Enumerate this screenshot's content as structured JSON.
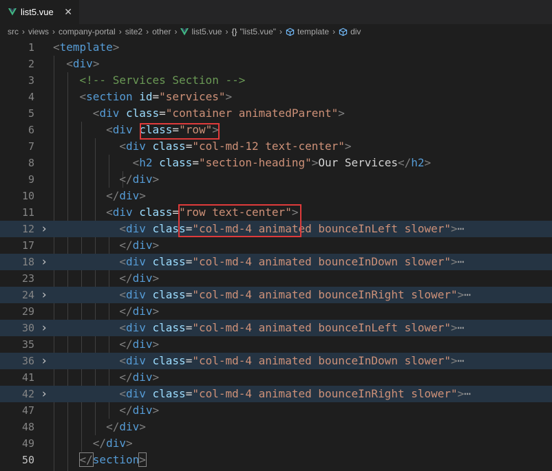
{
  "tab": {
    "title": "list5.vue",
    "close": "✕"
  },
  "breadcrumb": {
    "items": [
      {
        "label": "src",
        "icon": null
      },
      {
        "label": "views",
        "icon": null
      },
      {
        "label": "company-portal",
        "icon": null
      },
      {
        "label": "site2",
        "icon": null
      },
      {
        "label": "other",
        "icon": null
      },
      {
        "label": "list5.vue",
        "icon": "vue-icon"
      },
      {
        "label": "\"list5.vue\"",
        "icon": "braces-icon",
        "icon_text": "{}"
      },
      {
        "label": "template",
        "icon": "cube-icon"
      },
      {
        "label": "div",
        "icon": "cube-icon"
      }
    ],
    "separator": "›"
  },
  "colors": {
    "vue_green": "#41b883",
    "highlight_red": "#e03b3b",
    "folded_bg": "#253443"
  },
  "lines": [
    {
      "num": "1",
      "tokens": [
        [
          "br",
          "<"
        ],
        [
          "tag",
          "template"
        ],
        [
          "br",
          ">"
        ]
      ]
    },
    {
      "num": "2",
      "tokens": [
        [
          "tx",
          "  "
        ],
        [
          "br",
          "<"
        ],
        [
          "tag",
          "div"
        ],
        [
          "br",
          ">"
        ]
      ]
    },
    {
      "num": "3",
      "tokens": [
        [
          "tx",
          "    "
        ],
        [
          "cmt",
          "<!-- Services Section -->"
        ]
      ]
    },
    {
      "num": "4",
      "tokens": [
        [
          "tx",
          "    "
        ],
        [
          "br",
          "<"
        ],
        [
          "tag",
          "section"
        ],
        [
          "tx",
          " "
        ],
        [
          "attr",
          "id"
        ],
        [
          "tx",
          "="
        ],
        [
          "str",
          "\"services\""
        ],
        [
          "br",
          ">"
        ]
      ]
    },
    {
      "num": "5",
      "tokens": [
        [
          "tx",
          "      "
        ],
        [
          "br",
          "<"
        ],
        [
          "tag",
          "div"
        ],
        [
          "tx",
          " "
        ],
        [
          "attr",
          "class"
        ],
        [
          "tx",
          "="
        ],
        [
          "str",
          "\"container animatedParent\""
        ],
        [
          "br",
          ">"
        ]
      ]
    },
    {
      "num": "6",
      "tokens": [
        [
          "tx",
          "        "
        ],
        [
          "br",
          "<"
        ],
        [
          "tag",
          "div"
        ],
        [
          "tx",
          " "
        ],
        [
          "attr",
          "class"
        ],
        [
          "tx",
          "="
        ],
        [
          "str",
          "\"row\""
        ],
        [
          "br",
          ">"
        ]
      ]
    },
    {
      "num": "7",
      "tokens": [
        [
          "tx",
          "          "
        ],
        [
          "br",
          "<"
        ],
        [
          "tag",
          "div"
        ],
        [
          "tx",
          " "
        ],
        [
          "attr",
          "class"
        ],
        [
          "tx",
          "="
        ],
        [
          "str",
          "\"col-md-12 text-center\""
        ],
        [
          "br",
          ">"
        ]
      ]
    },
    {
      "num": "8",
      "tokens": [
        [
          "tx",
          "            "
        ],
        [
          "br",
          "<"
        ],
        [
          "tag",
          "h2"
        ],
        [
          "tx",
          " "
        ],
        [
          "attr",
          "class"
        ],
        [
          "tx",
          "="
        ],
        [
          "str",
          "\"section-heading\""
        ],
        [
          "br",
          ">"
        ],
        [
          "tx",
          "Our Services"
        ],
        [
          "br",
          "</"
        ],
        [
          "tag",
          "h2"
        ],
        [
          "br",
          ">"
        ]
      ]
    },
    {
      "num": "9",
      "tokens": [
        [
          "tx",
          "          "
        ],
        [
          "br",
          "</"
        ],
        [
          "tag",
          "div"
        ],
        [
          "br",
          ">"
        ]
      ]
    },
    {
      "num": "10",
      "tokens": [
        [
          "tx",
          "        "
        ],
        [
          "br",
          "</"
        ],
        [
          "tag",
          "div"
        ],
        [
          "br",
          ">"
        ]
      ]
    },
    {
      "num": "11",
      "tokens": [
        [
          "tx",
          "        "
        ],
        [
          "br",
          "<"
        ],
        [
          "tag",
          "div"
        ],
        [
          "tx",
          " "
        ],
        [
          "attr",
          "class"
        ],
        [
          "tx",
          "="
        ],
        [
          "str",
          "\"row text-center\""
        ],
        [
          "br",
          ">"
        ]
      ]
    },
    {
      "num": "12",
      "folded": true,
      "tokens": [
        [
          "tx",
          "          "
        ],
        [
          "br",
          "<"
        ],
        [
          "tag",
          "div"
        ],
        [
          "tx",
          " "
        ],
        [
          "attr",
          "class"
        ],
        [
          "tx",
          "="
        ],
        [
          "str",
          "\"col-md-4 animated bounceInLeft slower\""
        ],
        [
          "br",
          ">"
        ],
        [
          "dots",
          "⋯"
        ]
      ]
    },
    {
      "num": "17",
      "tokens": [
        [
          "tx",
          "          "
        ],
        [
          "br",
          "</"
        ],
        [
          "tag",
          "div"
        ],
        [
          "br",
          ">"
        ]
      ]
    },
    {
      "num": "18",
      "folded": true,
      "tokens": [
        [
          "tx",
          "          "
        ],
        [
          "br",
          "<"
        ],
        [
          "tag",
          "div"
        ],
        [
          "tx",
          " "
        ],
        [
          "attr",
          "class"
        ],
        [
          "tx",
          "="
        ],
        [
          "str",
          "\"col-md-4 animated bounceInDown slower\""
        ],
        [
          "br",
          ">"
        ],
        [
          "dots",
          "⋯"
        ]
      ]
    },
    {
      "num": "23",
      "tokens": [
        [
          "tx",
          "          "
        ],
        [
          "br",
          "</"
        ],
        [
          "tag",
          "div"
        ],
        [
          "br",
          ">"
        ]
      ]
    },
    {
      "num": "24",
      "folded": true,
      "tokens": [
        [
          "tx",
          "          "
        ],
        [
          "br",
          "<"
        ],
        [
          "tag",
          "div"
        ],
        [
          "tx",
          " "
        ],
        [
          "attr",
          "class"
        ],
        [
          "tx",
          "="
        ],
        [
          "str",
          "\"col-md-4 animated bounceInRight slower\""
        ],
        [
          "br",
          ">"
        ],
        [
          "dots",
          "⋯"
        ]
      ]
    },
    {
      "num": "29",
      "tokens": [
        [
          "tx",
          "          "
        ],
        [
          "br",
          "</"
        ],
        [
          "tag",
          "div"
        ],
        [
          "br",
          ">"
        ]
      ]
    },
    {
      "num": "30",
      "folded": true,
      "tokens": [
        [
          "tx",
          "          "
        ],
        [
          "br",
          "<"
        ],
        [
          "tag",
          "div"
        ],
        [
          "tx",
          " "
        ],
        [
          "attr",
          "class"
        ],
        [
          "tx",
          "="
        ],
        [
          "str",
          "\"col-md-4 animated bounceInLeft slower\""
        ],
        [
          "br",
          ">"
        ],
        [
          "dots",
          "⋯"
        ]
      ]
    },
    {
      "num": "35",
      "tokens": [
        [
          "tx",
          "          "
        ],
        [
          "br",
          "</"
        ],
        [
          "tag",
          "div"
        ],
        [
          "br",
          ">"
        ]
      ]
    },
    {
      "num": "36",
      "folded": true,
      "tokens": [
        [
          "tx",
          "          "
        ],
        [
          "br",
          "<"
        ],
        [
          "tag",
          "div"
        ],
        [
          "tx",
          " "
        ],
        [
          "attr",
          "class"
        ],
        [
          "tx",
          "="
        ],
        [
          "str",
          "\"col-md-4 animated bounceInDown slower\""
        ],
        [
          "br",
          ">"
        ],
        [
          "dots",
          "⋯"
        ]
      ]
    },
    {
      "num": "41",
      "tokens": [
        [
          "tx",
          "          "
        ],
        [
          "br",
          "</"
        ],
        [
          "tag",
          "div"
        ],
        [
          "br",
          ">"
        ]
      ]
    },
    {
      "num": "42",
      "folded": true,
      "tokens": [
        [
          "tx",
          "          "
        ],
        [
          "br",
          "<"
        ],
        [
          "tag",
          "div"
        ],
        [
          "tx",
          " "
        ],
        [
          "attr",
          "class"
        ],
        [
          "tx",
          "="
        ],
        [
          "str",
          "\"col-md-4 animated bounceInRight slower\""
        ],
        [
          "br",
          ">"
        ],
        [
          "dots",
          "⋯"
        ]
      ]
    },
    {
      "num": "47",
      "tokens": [
        [
          "tx",
          "          "
        ],
        [
          "br",
          "</"
        ],
        [
          "tag",
          "div"
        ],
        [
          "br",
          ">"
        ]
      ]
    },
    {
      "num": "48",
      "tokens": [
        [
          "tx",
          "        "
        ],
        [
          "br",
          "</"
        ],
        [
          "tag",
          "div"
        ],
        [
          "br",
          ">"
        ]
      ]
    },
    {
      "num": "49",
      "tokens": [
        [
          "tx",
          "      "
        ],
        [
          "br",
          "</"
        ],
        [
          "tag",
          "div"
        ],
        [
          "br",
          ">"
        ]
      ]
    },
    {
      "num": "50",
      "active": true,
      "tokens": [
        [
          "tx",
          "    "
        ],
        [
          "br",
          "</"
        ],
        [
          "tag",
          "section"
        ],
        [
          "br",
          ">"
        ]
      ]
    }
  ]
}
